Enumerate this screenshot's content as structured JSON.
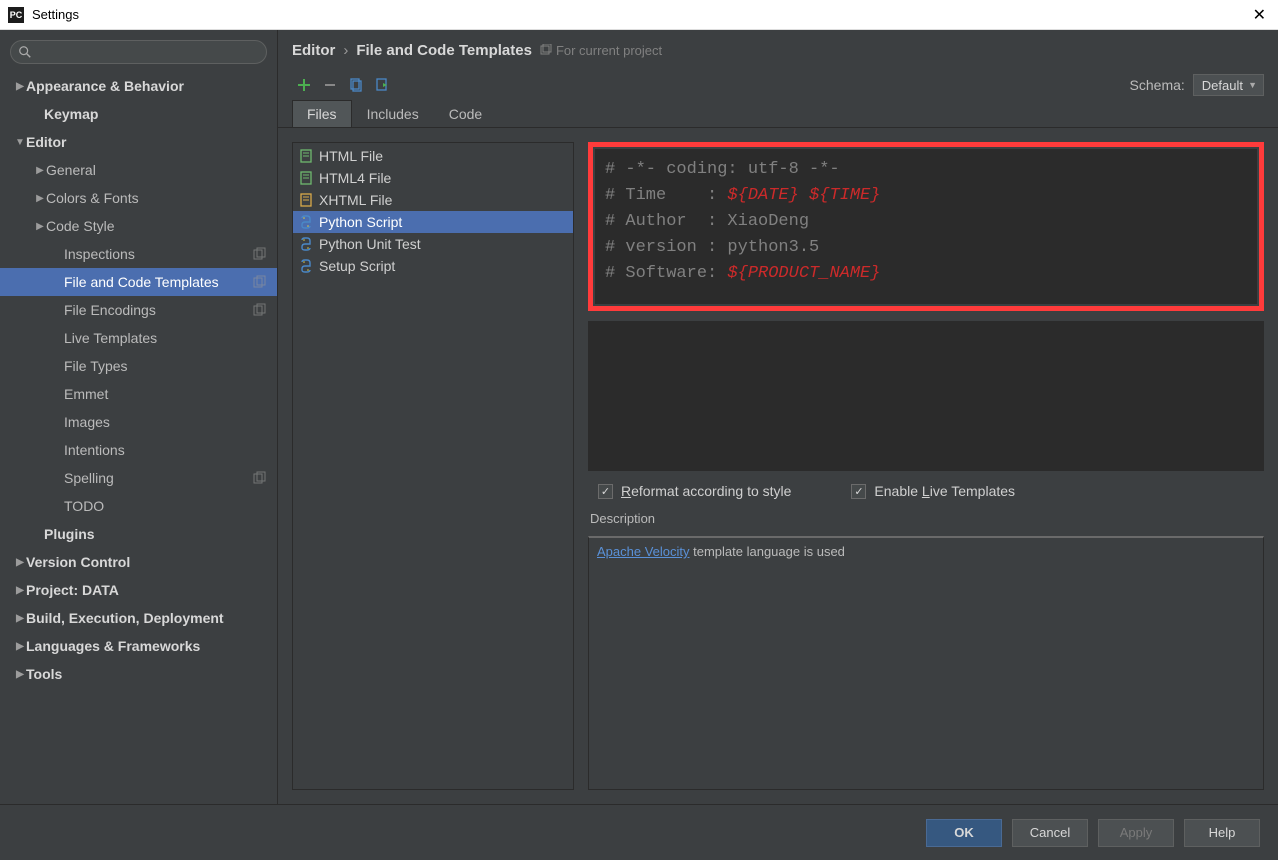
{
  "window": {
    "app_icon": "PC",
    "title": "Settings"
  },
  "sidebar": {
    "search_placeholder": "",
    "items": [
      {
        "label": "Appearance & Behavior",
        "bold": true,
        "indent": 14,
        "arrow": "right"
      },
      {
        "label": "Keymap",
        "bold": true,
        "indent": 32
      },
      {
        "label": "Editor",
        "bold": true,
        "indent": 14,
        "arrow": "down"
      },
      {
        "label": "General",
        "indent": 34,
        "arrow": "right"
      },
      {
        "label": "Colors & Fonts",
        "indent": 34,
        "arrow": "right"
      },
      {
        "label": "Code Style",
        "indent": 34,
        "arrow": "right"
      },
      {
        "label": "Inspections",
        "indent": 52,
        "copy": true
      },
      {
        "label": "File and Code Templates",
        "indent": 52,
        "copy": true,
        "selected": true
      },
      {
        "label": "File Encodings",
        "indent": 52,
        "copy": true
      },
      {
        "label": "Live Templates",
        "indent": 52
      },
      {
        "label": "File Types",
        "indent": 52
      },
      {
        "label": "Emmet",
        "indent": 52
      },
      {
        "label": "Images",
        "indent": 52
      },
      {
        "label": "Intentions",
        "indent": 52
      },
      {
        "label": "Spelling",
        "indent": 52,
        "copy": true
      },
      {
        "label": "TODO",
        "indent": 52
      },
      {
        "label": "Plugins",
        "bold": true,
        "indent": 32
      },
      {
        "label": "Version Control",
        "bold": true,
        "indent": 14,
        "arrow": "right"
      },
      {
        "label": "Project: DATA",
        "bold": true,
        "indent": 14,
        "arrow": "right"
      },
      {
        "label": "Build, Execution, Deployment",
        "bold": true,
        "indent": 14,
        "arrow": "right"
      },
      {
        "label": "Languages & Frameworks",
        "bold": true,
        "indent": 14,
        "arrow": "right"
      },
      {
        "label": "Tools",
        "bold": true,
        "indent": 14,
        "arrow": "right"
      }
    ]
  },
  "breadcrumb": {
    "a": "Editor",
    "sep": "›",
    "b": "File and Code Templates",
    "scope": "For current project"
  },
  "schema": {
    "label": "Schema:",
    "value": "Default"
  },
  "tabs": [
    {
      "label": "Files",
      "active": true
    },
    {
      "label": "Includes"
    },
    {
      "label": "Code"
    }
  ],
  "templates": [
    {
      "label": "HTML File",
      "icon": "html"
    },
    {
      "label": "HTML4 File",
      "icon": "html"
    },
    {
      "label": "XHTML File",
      "icon": "xhtml"
    },
    {
      "label": "Python Script",
      "icon": "py",
      "selected": true
    },
    {
      "label": "Python Unit Test",
      "icon": "py"
    },
    {
      "label": "Setup Script",
      "icon": "py"
    }
  ],
  "editor": {
    "l1_a": "# -*- coding: utf-8 -*-",
    "l2_a": "# Time    : ",
    "l2_b": "${DATE} ${TIME}",
    "l3_a": "# Author  : XiaoDeng",
    "l4_a": "# version : python3.5",
    "l5_a": "# Software: ",
    "l5_b": "${PRODUCT_NAME}"
  },
  "checks": {
    "reformat_pre": "R",
    "reformat": "eformat according to style",
    "live_pre": "Enable ",
    "live_u": "L",
    "live_post": "ive Templates"
  },
  "description": {
    "label": "Description",
    "link": "Apache Velocity",
    "text_after": " template language is used"
  },
  "footer": {
    "ok": "OK",
    "cancel": "Cancel",
    "apply": "Apply",
    "help": "Help"
  }
}
